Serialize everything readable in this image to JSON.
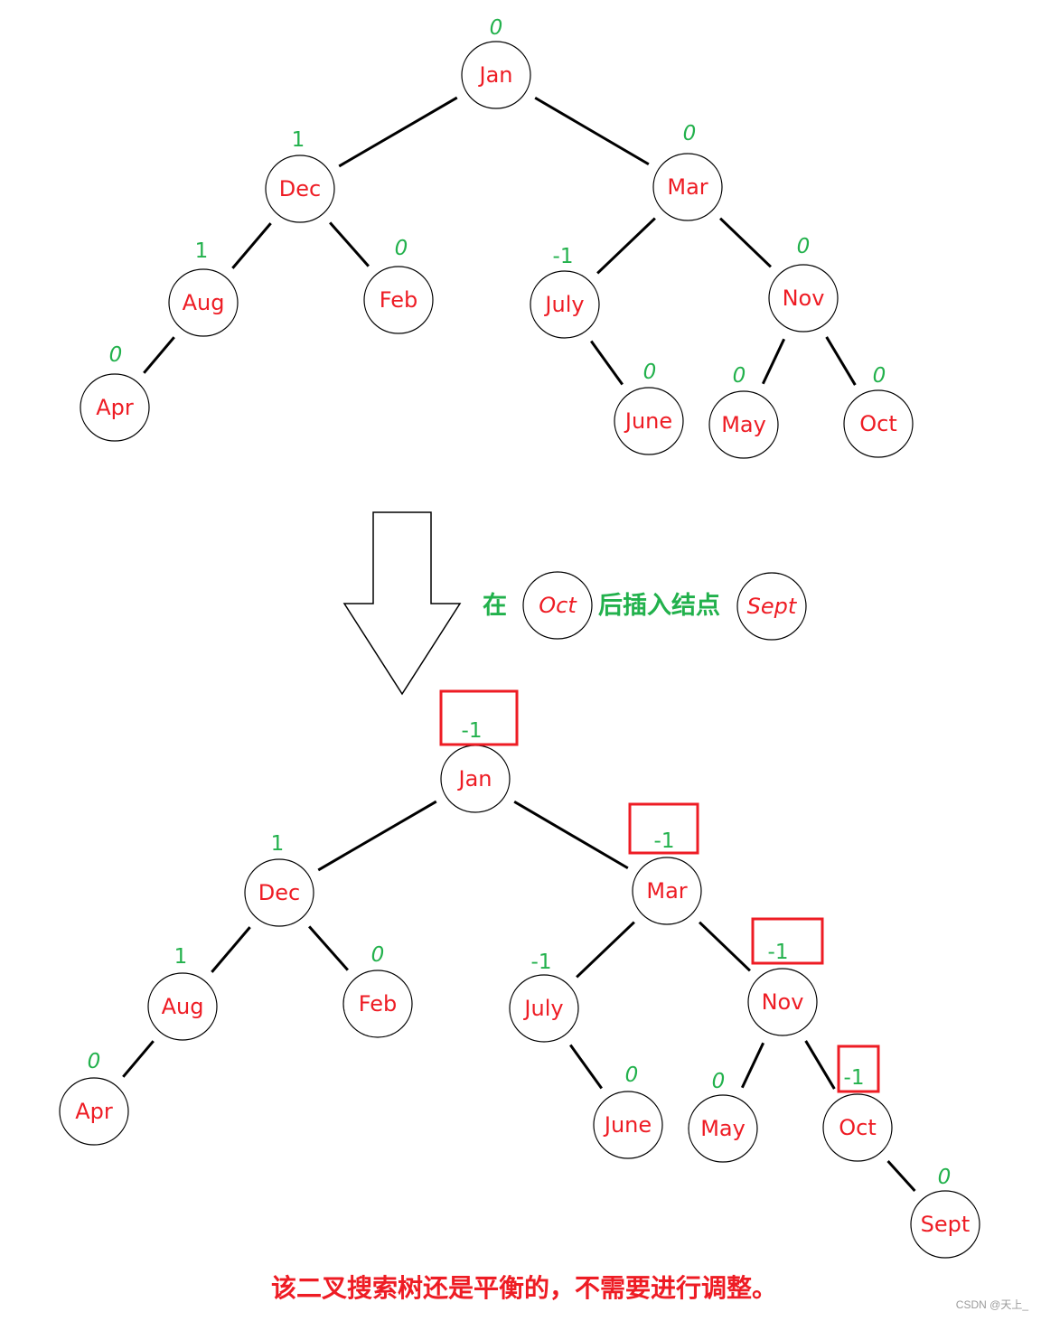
{
  "colors": {
    "node_text": "#ee1c24",
    "balance_factor": "#22b14c",
    "highlight_box": "#ee1c24",
    "edge": "#000000"
  },
  "before_tree": {
    "nodes": [
      {
        "id": "Jan",
        "label": "Jan",
        "bf": "0",
        "parent": null
      },
      {
        "id": "Dec",
        "label": "Dec",
        "bf": "1",
        "parent": "Jan"
      },
      {
        "id": "Mar",
        "label": "Mar",
        "bf": "0",
        "parent": "Jan"
      },
      {
        "id": "Aug",
        "label": "Aug",
        "bf": "1",
        "parent": "Dec"
      },
      {
        "id": "Feb",
        "label": "Feb",
        "bf": "0",
        "parent": "Dec"
      },
      {
        "id": "July",
        "label": "July",
        "bf": "-1",
        "parent": "Mar"
      },
      {
        "id": "Nov",
        "label": "Nov",
        "bf": "0",
        "parent": "Mar"
      },
      {
        "id": "Apr",
        "label": "Apr",
        "bf": "0",
        "parent": "Aug"
      },
      {
        "id": "June",
        "label": "June",
        "bf": "0",
        "parent": "July"
      },
      {
        "id": "May",
        "label": "May",
        "bf": "0",
        "parent": "Nov"
      },
      {
        "id": "Oct",
        "label": "Oct",
        "bf": "0",
        "parent": "Nov"
      }
    ]
  },
  "step": {
    "prefix": "在",
    "node_after": "Oct",
    "middle": "后插入结点",
    "inserted_node": "Sept"
  },
  "after_tree": {
    "nodes": [
      {
        "id": "Jan",
        "label": "Jan",
        "bf": "-1",
        "parent": null,
        "highlighted": true
      },
      {
        "id": "Dec",
        "label": "Dec",
        "bf": "1",
        "parent": "Jan",
        "highlighted": false
      },
      {
        "id": "Mar",
        "label": "Mar",
        "bf": "-1",
        "parent": "Jan",
        "highlighted": true
      },
      {
        "id": "Aug",
        "label": "Aug",
        "bf": "1",
        "parent": "Dec",
        "highlighted": false
      },
      {
        "id": "Feb",
        "label": "Feb",
        "bf": "0",
        "parent": "Dec",
        "highlighted": false
      },
      {
        "id": "July",
        "label": "July",
        "bf": "-1",
        "parent": "Mar",
        "highlighted": false
      },
      {
        "id": "Nov",
        "label": "Nov",
        "bf": "-1",
        "parent": "Mar",
        "highlighted": true
      },
      {
        "id": "Apr",
        "label": "Apr",
        "bf": "0",
        "parent": "Aug",
        "highlighted": false
      },
      {
        "id": "June",
        "label": "June",
        "bf": "0",
        "parent": "July",
        "highlighted": false
      },
      {
        "id": "May",
        "label": "May",
        "bf": "0",
        "parent": "Nov",
        "highlighted": false
      },
      {
        "id": "Oct",
        "label": "Oct",
        "bf": "-1",
        "parent": "Nov",
        "highlighted": true
      },
      {
        "id": "Sept",
        "label": "Sept",
        "bf": "0",
        "parent": "Oct",
        "highlighted": false
      }
    ]
  },
  "conclusion": "该二叉搜索树还是平衡的，不需要进行调整。",
  "watermark": "CSDN @天上_"
}
